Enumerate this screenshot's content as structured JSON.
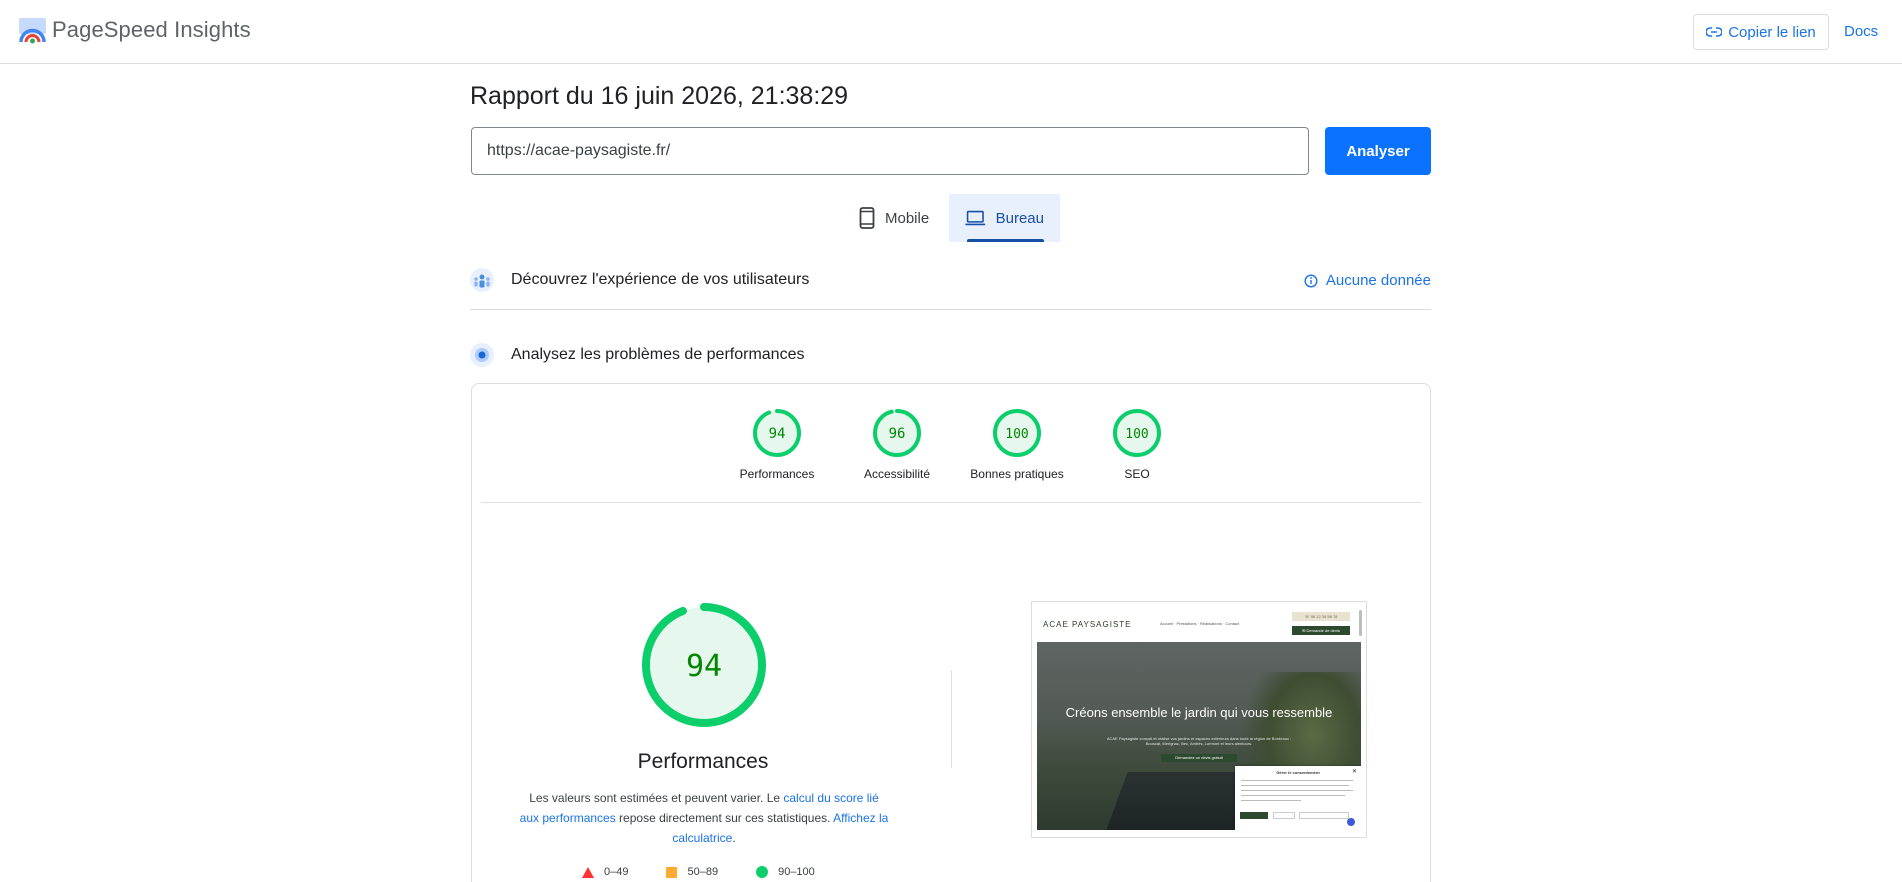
{
  "header": {
    "brand": "PageSpeed Insights",
    "copy_link_label": "Copier le lien",
    "docs_label": "Docs"
  },
  "report": {
    "title": "Rapport du 16 juin 2026, 21:38:29",
    "url_value": "https://acae-paysagiste.fr/",
    "analyze_label": "Analyser"
  },
  "tabs": [
    {
      "label": "Mobile",
      "selected": false,
      "icon": "smartphone-icon"
    },
    {
      "label": "Bureau",
      "selected": true,
      "icon": "laptop-icon"
    }
  ],
  "sections": {
    "crux": {
      "title": "Découvrez l'expérience de vos utilisateurs",
      "status": "Aucune donnée"
    },
    "lab": {
      "title": "Analysez les problèmes de performances"
    }
  },
  "scores": [
    {
      "value": "94",
      "label": "Performances",
      "fraction": 0.94
    },
    {
      "value": "96",
      "label": "Accessibilité",
      "fraction": 0.96
    },
    {
      "value": "100",
      "label": "Bonnes pratiques",
      "fraction": 1.0
    },
    {
      "value": "100",
      "label": "SEO",
      "fraction": 1.0
    }
  ],
  "performance": {
    "score": "94",
    "fraction": 0.94,
    "title": "Performances",
    "desc_part1": "Les valeurs sont estimées et peuvent varier. Le ",
    "desc_link1": "calcul du score lié aux performances",
    "desc_part2": " repose directement sur ces statistiques. ",
    "desc_link2": "Affichez la calculatrice",
    "desc_part3": "."
  },
  "legend": [
    {
      "label": "0–49",
      "shape": "triangle",
      "color": "#ff3333"
    },
    {
      "label": "50–89",
      "shape": "square",
      "color": "#ffaa33"
    },
    {
      "label": "90–100",
      "shape": "circle",
      "color": "#0cce6b"
    }
  ],
  "colors": {
    "good": "#0cce6b",
    "good_text": "#008800",
    "good_fill": "#e6f8ee",
    "accent": "#1a73e8",
    "button": "#0b72ff"
  },
  "thumbnail": {
    "logo": "ACAE PAYSAGISTE",
    "menu": "Accueil · Prestations · Réalisations · Contact",
    "phone": "☏ 06 12 34 56 78",
    "cta": "✉ Demande de devis",
    "headline": "Créons ensemble le jardin qui vous ressemble",
    "subtext": "ACAE Paysagiste conçoit et réalise vos jardins et espaces extérieurs dans toute la région de Bordeaux : Bouscat, Merignac, Bec, Ambès, Lormont et leurs alentours.",
    "button": "Demandez un devis gratuit",
    "cookie_title": "Gérer le consentement",
    "cookie_close": "✕"
  }
}
